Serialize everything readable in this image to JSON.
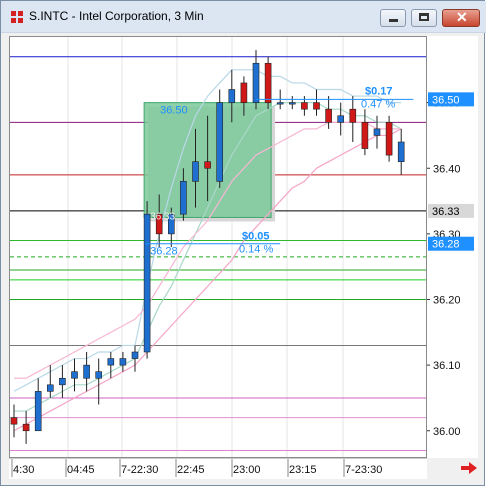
{
  "window": {
    "title": "S.INTC - Intel Corporation, 3 Min"
  },
  "titlebar_buttons": {
    "minimize": "minimize",
    "maximize": "maximize",
    "close": "close"
  },
  "price_axis": {
    "ticks": [
      "36.50",
      "36.40",
      "36.30",
      "36.20",
      "36.10",
      "36.00"
    ],
    "markers": [
      {
        "label": "36.50",
        "color": "#1e90ff"
      },
      {
        "label": "36.33",
        "color": "#d8d8d8"
      },
      {
        "label": "36.28",
        "color": "#1e90ff"
      }
    ]
  },
  "time_axis": {
    "labels": [
      "4:30",
      "04:45",
      "7-22:30",
      "22:45",
      "23:00",
      "23:15",
      "7-23:30"
    ]
  },
  "annotations": {
    "box_top_price": "36.50",
    "box_bottom_price": "36.28",
    "box_inner_label": "36.33",
    "upper_change": "$0.17",
    "upper_pct": "0.47 %",
    "lower_change": "$0.05",
    "lower_pct": "0.14 %"
  },
  "colors": {
    "up_candle": "#1f6fd0",
    "down_candle": "#d01818",
    "box_fill": "#7bc99a",
    "accent_blue": "#1e90ff"
  },
  "chart_data": {
    "type": "candlestick",
    "symbol": "S.INTC",
    "interval": "3 Min",
    "ylim": [
      35.96,
      36.6
    ],
    "candles": [
      {
        "o": 36.02,
        "h": 36.04,
        "l": 35.99,
        "c": 36.01
      },
      {
        "o": 36.01,
        "h": 36.03,
        "l": 35.98,
        "c": 36.0
      },
      {
        "o": 36.0,
        "h": 36.08,
        "l": 36.0,
        "c": 36.06
      },
      {
        "o": 36.06,
        "h": 36.1,
        "l": 36.05,
        "c": 36.07
      },
      {
        "o": 36.07,
        "h": 36.1,
        "l": 36.05,
        "c": 36.08
      },
      {
        "o": 36.08,
        "h": 36.11,
        "l": 36.06,
        "c": 36.09
      },
      {
        "o": 36.08,
        "h": 36.12,
        "l": 36.06,
        "c": 36.1
      },
      {
        "o": 36.08,
        "h": 36.11,
        "l": 36.04,
        "c": 36.09
      },
      {
        "o": 36.1,
        "h": 36.12,
        "l": 36.08,
        "c": 36.11
      },
      {
        "o": 36.1,
        "h": 36.12,
        "l": 36.09,
        "c": 36.11
      },
      {
        "o": 36.11,
        "h": 36.13,
        "l": 36.09,
        "c": 36.12
      },
      {
        "o": 36.12,
        "h": 36.35,
        "l": 36.11,
        "c": 36.33
      },
      {
        "o": 36.33,
        "h": 36.36,
        "l": 36.28,
        "c": 36.3
      },
      {
        "o": 36.3,
        "h": 36.34,
        "l": 36.28,
        "c": 36.33
      },
      {
        "o": 36.33,
        "h": 36.4,
        "l": 36.32,
        "c": 36.38
      },
      {
        "o": 36.38,
        "h": 36.46,
        "l": 36.34,
        "c": 36.41
      },
      {
        "o": 36.41,
        "h": 36.48,
        "l": 36.35,
        "c": 36.4
      },
      {
        "o": 36.38,
        "h": 36.52,
        "l": 36.37,
        "c": 36.5
      },
      {
        "o": 36.5,
        "h": 36.55,
        "l": 36.47,
        "c": 36.52
      },
      {
        "o": 36.53,
        "h": 36.54,
        "l": 36.48,
        "c": 36.5
      },
      {
        "o": 36.5,
        "h": 36.58,
        "l": 36.49,
        "c": 36.56
      },
      {
        "o": 36.56,
        "h": 36.57,
        "l": 36.49,
        "c": 36.5
      },
      {
        "o": 36.5,
        "h": 36.52,
        "l": 36.49,
        "c": 36.5
      },
      {
        "o": 36.5,
        "h": 36.51,
        "l": 36.49,
        "c": 36.5
      },
      {
        "o": 36.5,
        "h": 36.51,
        "l": 36.48,
        "c": 36.49
      },
      {
        "o": 36.5,
        "h": 36.52,
        "l": 36.48,
        "c": 36.49
      },
      {
        "o": 36.49,
        "h": 36.51,
        "l": 36.46,
        "c": 36.47
      },
      {
        "o": 36.47,
        "h": 36.5,
        "l": 36.45,
        "c": 36.48
      },
      {
        "o": 36.49,
        "h": 36.51,
        "l": 36.44,
        "c": 36.47
      },
      {
        "o": 36.47,
        "h": 36.49,
        "l": 36.42,
        "c": 36.43
      },
      {
        "o": 36.45,
        "h": 36.48,
        "l": 36.43,
        "c": 36.46
      },
      {
        "o": 36.47,
        "h": 36.48,
        "l": 36.41,
        "c": 36.42
      },
      {
        "o": 36.41,
        "h": 36.46,
        "l": 36.39,
        "c": 36.44
      }
    ],
    "horizontal_lines": [
      {
        "price": 36.57,
        "color": "#1a1acc"
      },
      {
        "price": 36.47,
        "color": "#8a1a7a"
      },
      {
        "price": 36.39,
        "color": "#c02020"
      },
      {
        "price": 36.335,
        "color": "#000000"
      },
      {
        "price": 36.29,
        "color": "#2db82d"
      },
      {
        "price": 36.245,
        "color": "#22aa22"
      },
      {
        "price": 36.23,
        "color": "#22cc22"
      },
      {
        "price": 36.2,
        "color": "#22aa22"
      },
      {
        "price": 36.13,
        "color": "#777777"
      },
      {
        "price": 36.05,
        "color": "#d060c0"
      },
      {
        "price": 36.02,
        "color": "#e090d0"
      },
      {
        "price": 35.97,
        "color": "#e080d0"
      }
    ],
    "bands": {
      "upper_pink": [
        36.0,
        36.01,
        36.02,
        36.03,
        36.04,
        36.05,
        36.06,
        36.07,
        36.08,
        36.09,
        36.1,
        36.12,
        36.14,
        36.16,
        36.18,
        36.2,
        36.22,
        36.24,
        36.26,
        36.29,
        36.31,
        36.33,
        36.35,
        36.37,
        36.38,
        36.4,
        36.41,
        36.42,
        36.43,
        36.44,
        36.45,
        36.45,
        36.46
      ],
      "mid_light": [
        36.03,
        36.03,
        36.04,
        36.05,
        36.06,
        36.07,
        36.07,
        36.08,
        36.09,
        36.1,
        36.11,
        36.15,
        36.19,
        36.22,
        36.26,
        36.3,
        36.34,
        36.38,
        36.42,
        36.45,
        36.48,
        36.49,
        36.5,
        36.5,
        36.5,
        36.5,
        36.49,
        36.49,
        36.48,
        36.48,
        36.47,
        36.47,
        36.46
      ],
      "upper_light": [
        36.06,
        36.07,
        36.08,
        36.09,
        36.1,
        36.11,
        36.11,
        36.12,
        36.12,
        36.13,
        36.13,
        36.22,
        36.3,
        36.37,
        36.43,
        36.48,
        36.51,
        36.53,
        36.55,
        36.55,
        36.55,
        36.54,
        36.54,
        36.53,
        36.53,
        36.52,
        36.52,
        36.52,
        36.51,
        36.51,
        36.51,
        36.5,
        36.5
      ],
      "lower_pink": [
        36.08,
        36.08,
        36.09,
        36.1,
        36.11,
        36.12,
        36.13,
        36.14,
        36.15,
        36.16,
        36.17,
        36.19,
        36.22,
        36.25,
        36.28,
        36.3,
        36.32,
        36.35,
        36.38,
        36.4,
        36.42,
        36.43,
        36.44,
        36.45,
        36.46,
        36.46,
        36.47,
        36.47,
        36.47,
        36.47,
        36.46,
        36.46,
        36.46
      ]
    },
    "rectangle": {
      "price_top": 36.5,
      "price_bottom": 36.325,
      "start_index": 11,
      "end_index": 21
    }
  }
}
